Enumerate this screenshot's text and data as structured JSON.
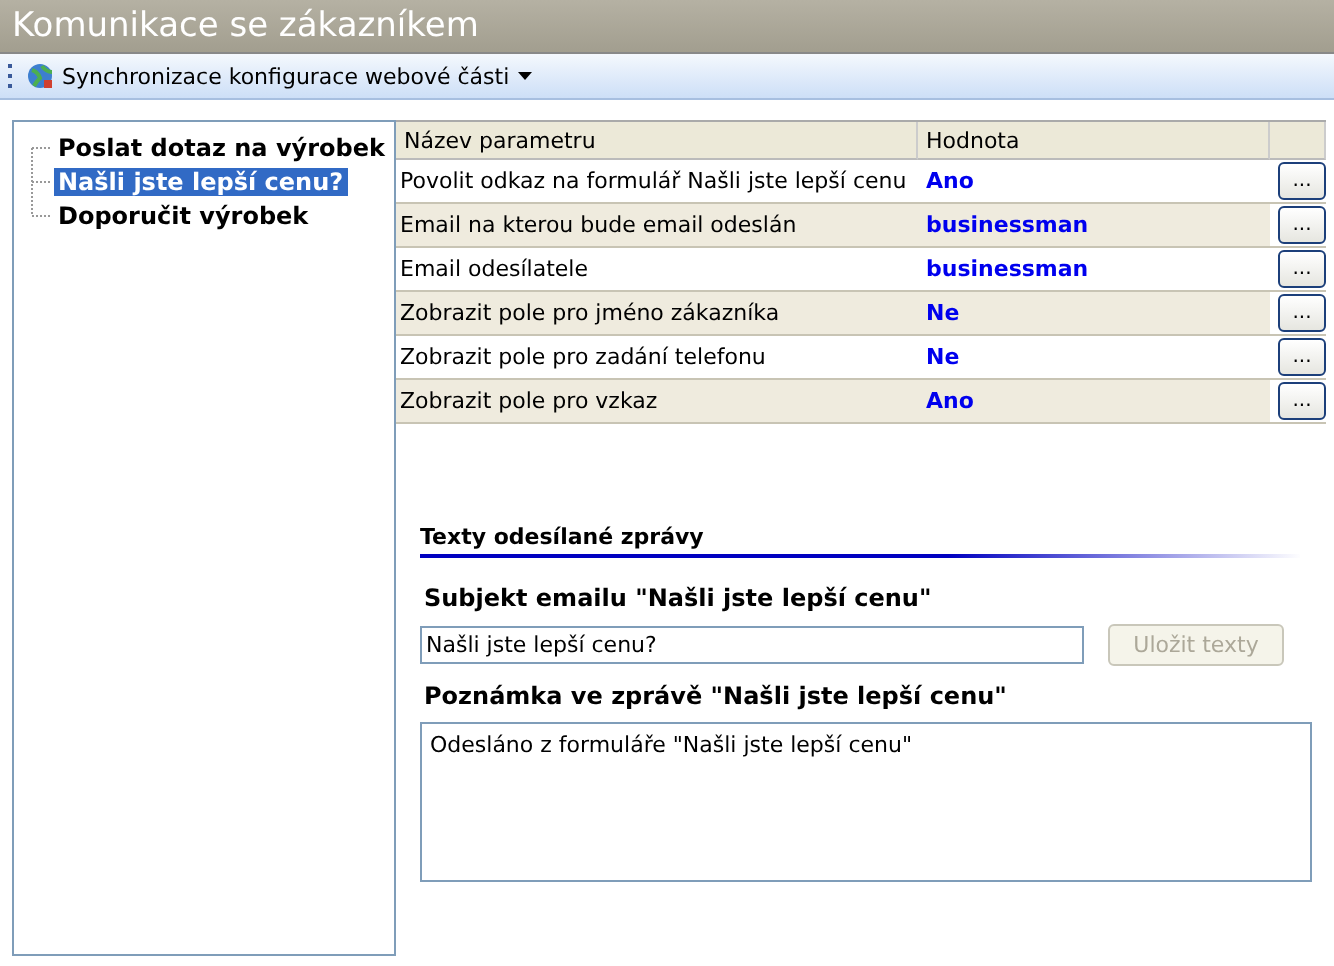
{
  "window": {
    "title": "Komunikace se zákazníkem"
  },
  "toolbar": {
    "items": [
      {
        "label": "Synchronizace konfigurace webové části",
        "kind": "dropdown"
      }
    ]
  },
  "tree": {
    "items": [
      {
        "label": "Poslat dotaz na výrobek",
        "selected": false
      },
      {
        "label": "Našli jste lepší cenu?",
        "selected": true
      },
      {
        "label": "Doporučit výrobek",
        "selected": false
      }
    ]
  },
  "grid": {
    "columns": [
      "Název parametru",
      "Hodnota"
    ],
    "rows": [
      {
        "name": "Povolit odkaz na formulář Našli jste lepší cenu",
        "value": "Ano",
        "button": "..."
      },
      {
        "name": "Email na kterou bude email odeslán",
        "value": "businessman",
        "button": "..."
      },
      {
        "name": "Email odesílatele",
        "value": "businessman",
        "button": "..."
      },
      {
        "name": "Zobrazit pole pro jméno zákazníka",
        "value": "Ne",
        "button": "..."
      },
      {
        "name": "Zobrazit pole pro zadání telefonu",
        "value": "Ne",
        "button": "..."
      },
      {
        "name": "Zobrazit pole pro vzkaz",
        "value": "Ano",
        "button": "..."
      }
    ]
  },
  "texts": {
    "title": "Texty odesílané zprávy",
    "subject_label": "Subjekt emailu \"Našli jste lepší cenu\"",
    "subject_value": "Našli jste lepší cenu?",
    "save_button": {
      "label": "Uložit texty",
      "disabled": true
    },
    "note_label": "Poznámka ve zprávě \"Našli jste lepší cenu\"",
    "note_value": "Odesláno z formuláře \"Našli jste lepší cenu\""
  }
}
